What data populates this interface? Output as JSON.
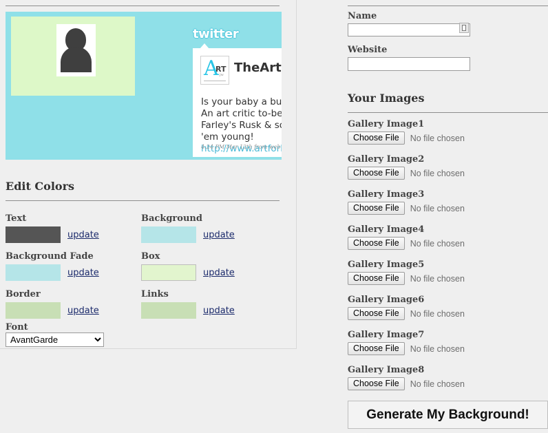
{
  "preview": {
    "background_color": "#8fe0e8",
    "box_color": "#ddf8c8",
    "twitter_logo": "twitter",
    "tweet": {
      "avatar_letter": "A",
      "avatar_rt": "RT",
      "avatar_sub": "jw",
      "username": "TheArtist",
      "line1": "Is your baby a bud",
      "line2": "An art critic to-be?",
      "line3": "Farley's Rusk & son",
      "line4": "'em young!",
      "link": "http://www.artforb",
      "timestamp": "4:24 PM Mar 12th from web"
    }
  },
  "edit_colors": {
    "title": "Edit Colors",
    "update_label": "update",
    "font_label": "Font",
    "font_selected": "AvantGarde",
    "font_options": [
      "AvantGarde"
    ],
    "swatches": [
      {
        "label": "Text",
        "color": "#555555",
        "outlined": false
      },
      {
        "label": "Background",
        "color": "#b5e5e8",
        "outlined": false
      },
      {
        "label": "Background Fade",
        "color": "#b5e5e8",
        "outlined": false
      },
      {
        "label": "Box",
        "color": "#e2f5ce",
        "outlined": true
      },
      {
        "label": "Border",
        "color": "#c8dfb5",
        "outlined": false
      },
      {
        "label": "Links",
        "color": "#c8dfb5",
        "outlined": false
      }
    ]
  },
  "form": {
    "name_label": "Name",
    "name_value": "",
    "name_placeholder": "",
    "website_label": "Website",
    "website_value": "",
    "website_placeholder": "",
    "autofill_icon": "contact-card-icon"
  },
  "images": {
    "title": "Your Images",
    "choose_file_label": "Choose File",
    "no_file_label": "No file chosen",
    "items": [
      {
        "label": "Gallery Image1"
      },
      {
        "label": "Gallery Image2"
      },
      {
        "label": "Gallery Image3"
      },
      {
        "label": "Gallery Image4"
      },
      {
        "label": "Gallery Image5"
      },
      {
        "label": "Gallery Image6"
      },
      {
        "label": "Gallery Image7"
      },
      {
        "label": "Gallery Image8"
      }
    ]
  },
  "generate_button_label": "Generate My Background!"
}
